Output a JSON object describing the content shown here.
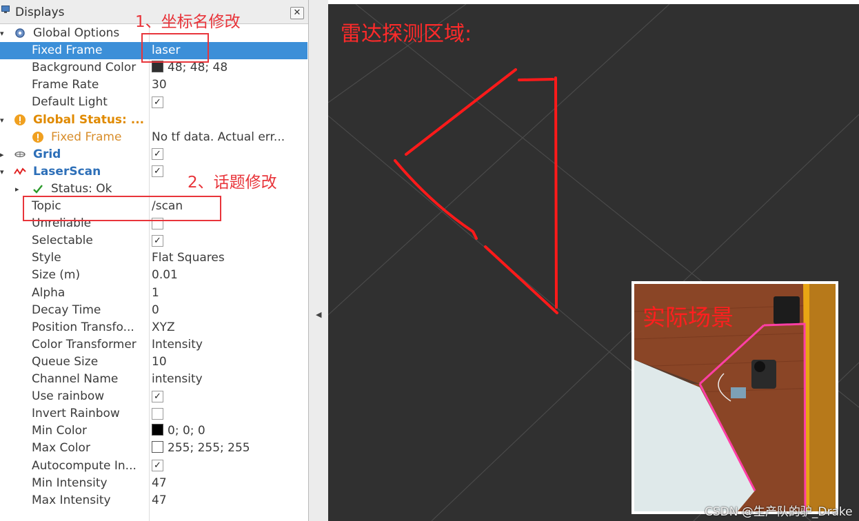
{
  "panel": {
    "title": "Displays",
    "close_glyph": "✕",
    "rows": [
      {
        "id": "global-options",
        "label": "Global Options",
        "value": "",
        "indent": 0,
        "expand": "open",
        "icon": "gear-icon",
        "style": "normal"
      },
      {
        "id": "fixed-frame",
        "label": "Fixed Frame",
        "value": "laser",
        "indent": 1,
        "style": "normal",
        "selected": true
      },
      {
        "id": "background-color",
        "label": "Background Color",
        "value": "48; 48; 48",
        "indent": 1,
        "swatch": "#303030"
      },
      {
        "id": "frame-rate",
        "label": "Frame Rate",
        "value": "30",
        "indent": 1
      },
      {
        "id": "default-light",
        "label": "Default Light",
        "value": "",
        "indent": 1,
        "check": true
      },
      {
        "id": "global-status",
        "label": "Global Status: ...",
        "value": "",
        "indent": 0,
        "expand": "open",
        "icon": "warning-icon",
        "style": "orange"
      },
      {
        "id": "status-fixed-frame",
        "label": "Fixed Frame",
        "value": "No tf data.  Actual err...",
        "indent": 1,
        "icon": "warning-icon",
        "style": "orange2"
      },
      {
        "id": "grid",
        "label": "Grid",
        "value": "",
        "indent": 0,
        "expand": "closed",
        "icon": "grid-icon",
        "style": "blue",
        "check": true
      },
      {
        "id": "laserscan",
        "label": "LaserScan",
        "value": "",
        "indent": 0,
        "expand": "open",
        "icon": "laserscan-icon",
        "style": "blue",
        "check": true
      },
      {
        "id": "status-ok",
        "label": "Status: Ok",
        "value": "",
        "indent": 1,
        "expand": "closed",
        "icon": "check-icon"
      },
      {
        "id": "topic",
        "label": "Topic",
        "value": "/scan",
        "indent": 1
      },
      {
        "id": "unreliable",
        "label": "Unreliable",
        "value": "",
        "indent": 1,
        "check": false
      },
      {
        "id": "selectable",
        "label": "Selectable",
        "value": "",
        "indent": 1,
        "check": true
      },
      {
        "id": "style",
        "label": "Style",
        "value": "Flat Squares",
        "indent": 1
      },
      {
        "id": "size",
        "label": "Size (m)",
        "value": "0.01",
        "indent": 1
      },
      {
        "id": "alpha",
        "label": "Alpha",
        "value": "1",
        "indent": 1
      },
      {
        "id": "decay-time",
        "label": "Decay Time",
        "value": "0",
        "indent": 1
      },
      {
        "id": "position-transformer",
        "label": "Position Transfo...",
        "value": "XYZ",
        "indent": 1
      },
      {
        "id": "color-transformer",
        "label": "Color Transformer",
        "value": "Intensity",
        "indent": 1
      },
      {
        "id": "queue-size",
        "label": "Queue Size",
        "value": "10",
        "indent": 1
      },
      {
        "id": "channel-name",
        "label": "Channel Name",
        "value": "intensity",
        "indent": 1
      },
      {
        "id": "use-rainbow",
        "label": "Use rainbow",
        "value": "",
        "indent": 1,
        "check": true
      },
      {
        "id": "invert-rainbow",
        "label": "Invert Rainbow",
        "value": "",
        "indent": 1,
        "check": false
      },
      {
        "id": "min-color",
        "label": "Min Color",
        "value": "0; 0; 0",
        "indent": 1,
        "swatch": "#000000"
      },
      {
        "id": "max-color",
        "label": "Max Color",
        "value": "255; 255; 255",
        "indent": 1,
        "swatch": "#ffffff"
      },
      {
        "id": "autocompute",
        "label": "Autocompute In...",
        "value": "",
        "indent": 1,
        "check": true
      },
      {
        "id": "min-intensity",
        "label": "Min Intensity",
        "value": "47",
        "indent": 1
      },
      {
        "id": "max-intensity",
        "label": "Max Intensity",
        "value": "47",
        "indent": 1
      }
    ]
  },
  "annotations": {
    "step1": "1、坐标名修改",
    "step2": "2、话题修改",
    "radar_area": "雷达探测区域:",
    "actual_scene": "实际场景"
  },
  "watermark": "CSDN @生产队的驴_Drake",
  "colors": {
    "viewport_bg": "#303030",
    "selection": "#3c8fd8",
    "annotation_red": "#e8343a",
    "scan_red": "#ff1a1a"
  }
}
